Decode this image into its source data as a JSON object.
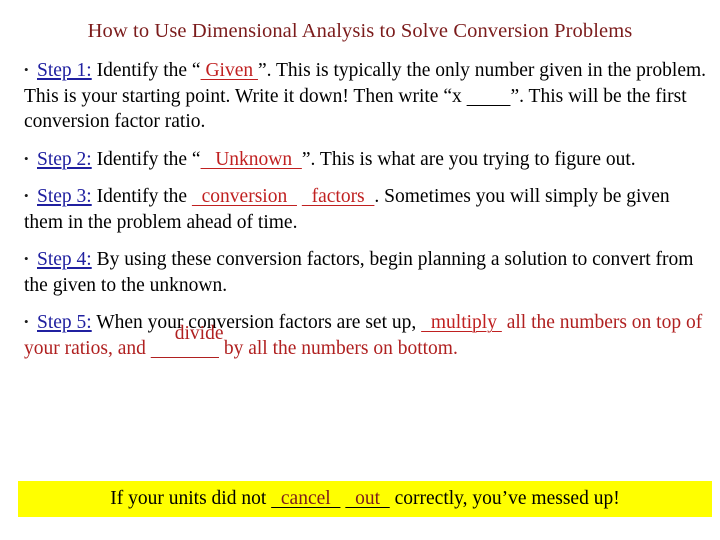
{
  "slide": {
    "title": "How to Use Dimensional Analysis to Solve Conversion Problems",
    "bullet_glyph": "•",
    "colors": {
      "title": "#7B1B1B",
      "step_label": "#2020A0",
      "answer_red": "#C02020",
      "banner_background": "#FFFF00",
      "banner_answer": "#7B1B1B",
      "body_text": "#000000"
    }
  },
  "steps": [
    {
      "label": "Step 1:",
      "t1": "  Identify the “",
      "answer1": " Given ",
      "t2": "”.  This is typically the only number given in the problem.  This is your starting point.  Write it down!  Then write “x ",
      "blank1": "         ",
      "t3": "”.  This will be the first conversion factor ratio."
    },
    {
      "label": "Step 2:",
      "t1": "  Identify the “",
      "answer1": "   Unknown  ",
      "t2": "”.  This is what are you trying to figure out."
    },
    {
      "label": "Step 3:",
      "t1": "  Identify the ",
      "answer1": "  conversion  ",
      "t2": " ",
      "answer2": "  factors  ",
      "t3": ".  Sometimes you will simply be given them in the problem ahead of time."
    },
    {
      "label": "Step 4:",
      "t1": "  By using these conversion factors, begin planning a solution to convert from the given to the unknown."
    },
    {
      "label": "Step 5:",
      "t1": "  When your conversion factors are set up, ",
      "answer1": "  multiply ",
      "t2": " all the numbers on top of your ratios, and ",
      "answer2": "divide",
      "blank2": "              ",
      "t3": " by all the numbers on bottom."
    }
  ],
  "banner": {
    "t1": "If your units did not ",
    "answer1": "  cancel  ",
    "t2": " ",
    "answer2": "  out  ",
    "t3": " correctly, you’ve messed up!"
  }
}
